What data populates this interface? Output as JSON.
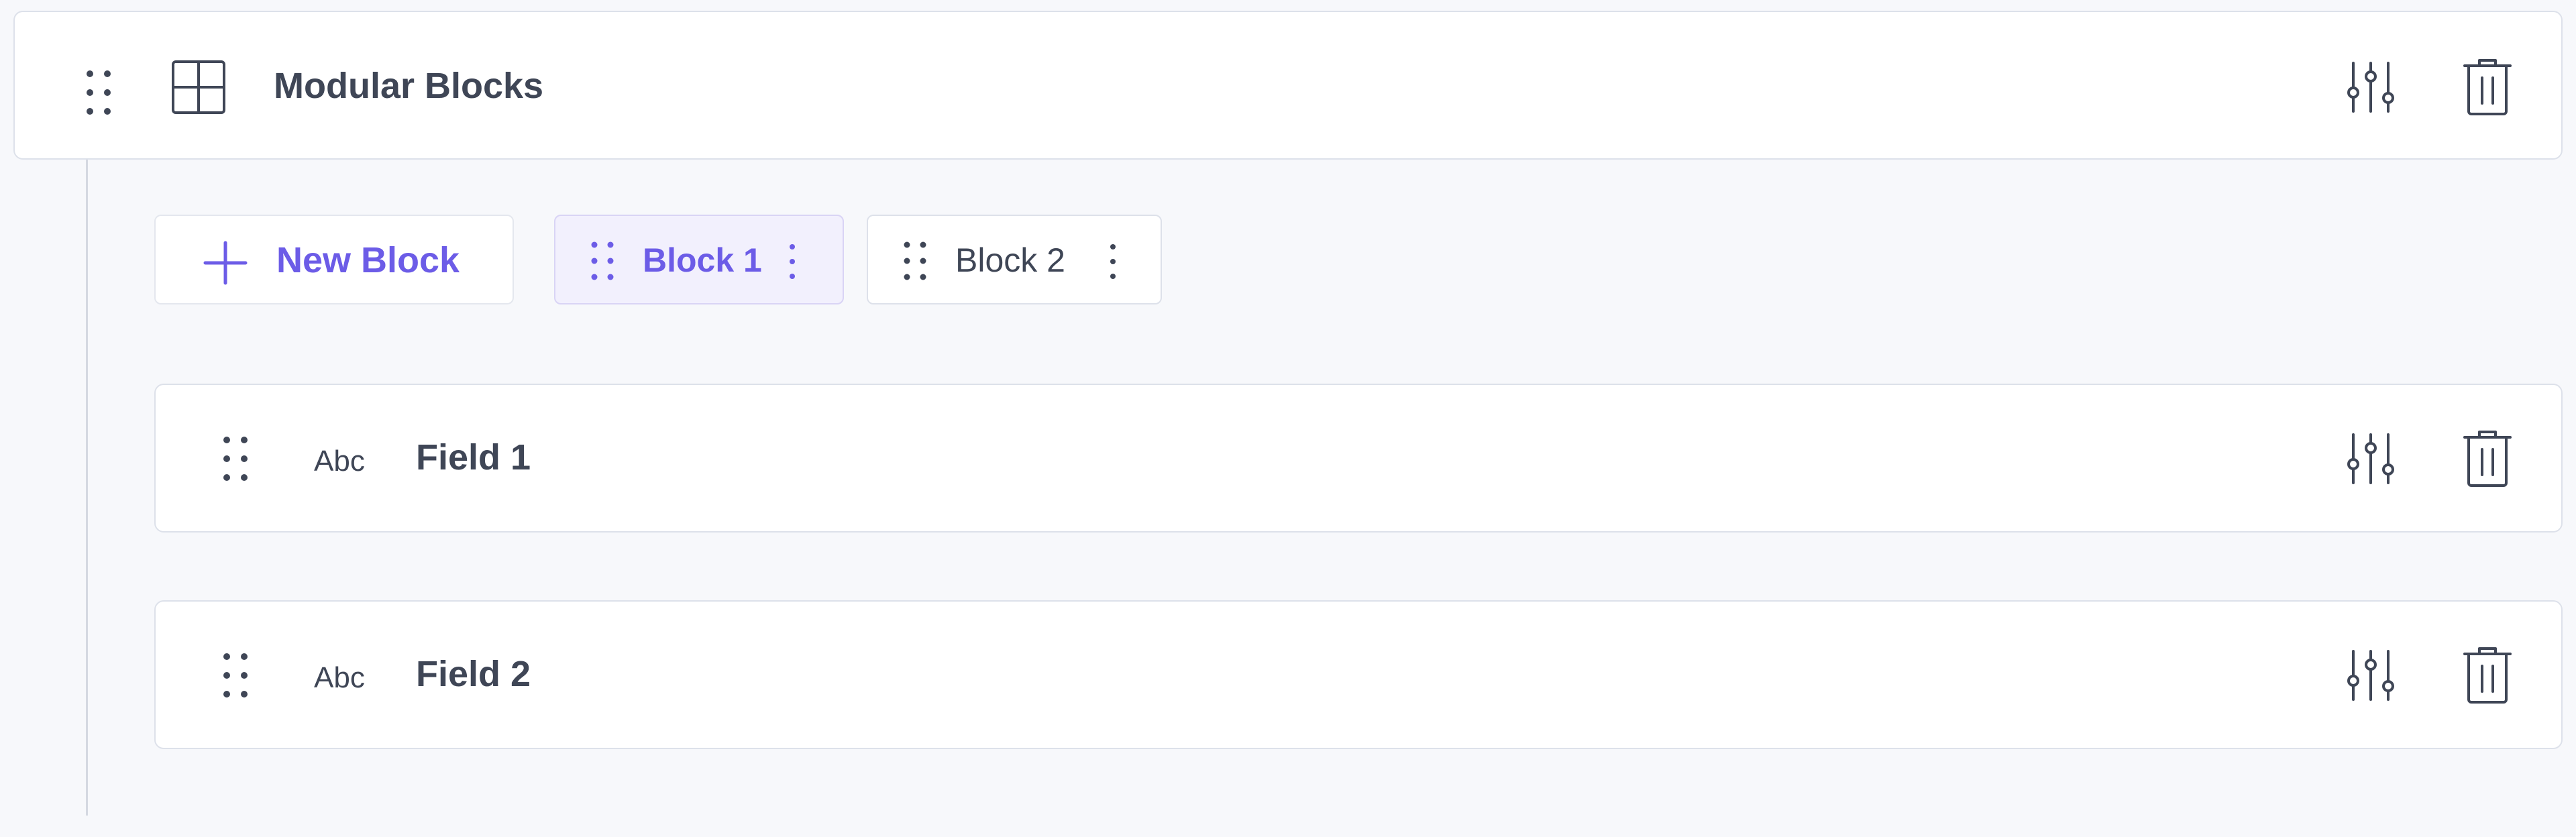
{
  "header": {
    "title": "Modular Blocks",
    "drag_icon": "drag-handle-icon",
    "type_icon": "grid-icon",
    "settings_icon": "sliders-icon",
    "delete_icon": "trash-icon"
  },
  "blocks_toolbar": {
    "new_block_label": "New Block",
    "add_icon": "plus-icon",
    "tabs": [
      {
        "label": "Block 1",
        "active": true
      },
      {
        "label": "Block 2",
        "active": false
      }
    ]
  },
  "fields": [
    {
      "label": "Field 1",
      "type_label": "Abc"
    },
    {
      "label": "Field 2",
      "type_label": "Abc"
    }
  ],
  "colors": {
    "accent": "#6c5ce7",
    "text": "#3f4656",
    "border": "#dde1ea",
    "background": "#f7f8fb",
    "active_tab_bg": "#f2f0fd"
  }
}
